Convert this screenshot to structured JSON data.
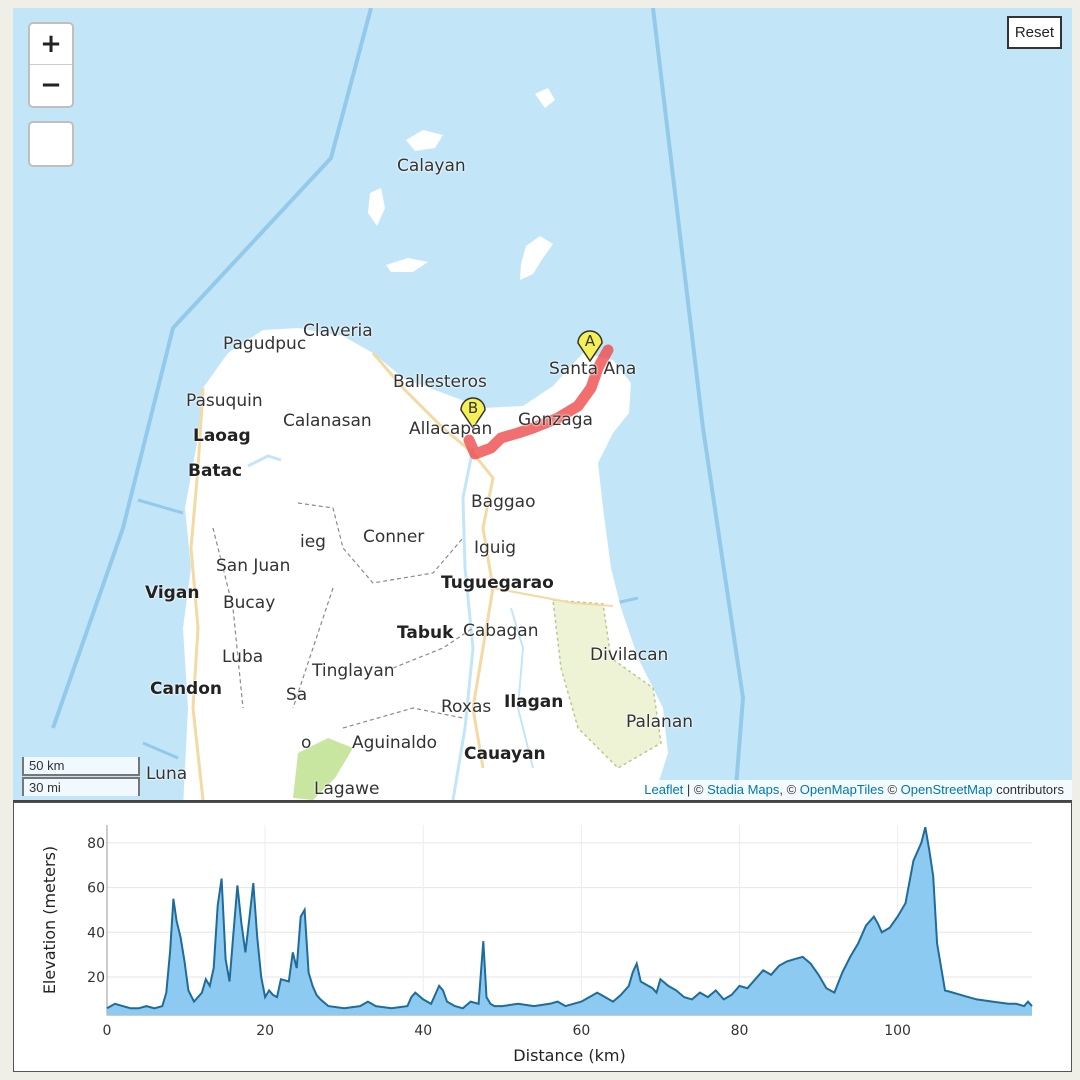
{
  "map": {
    "zoom_in_label": "+",
    "zoom_out_label": "−",
    "reset_label": "Reset",
    "scale_km": "50 km",
    "scale_mi": "30 mi",
    "attribution": {
      "leaflet": "Leaflet",
      "sep": " | © ",
      "stadia": "Stadia Maps",
      "mid": ", © ",
      "openmaptiles": "OpenMapTiles",
      "mid2": " © ",
      "osm": "OpenStreetMap",
      "tail": " contributors"
    },
    "markers": [
      {
        "label": "A"
      },
      {
        "label": "B"
      }
    ],
    "colors": {
      "water": "#c2e6f8",
      "land": "#ffffff",
      "route": "#ee4b4b",
      "marker": "#f6f057",
      "park": "#e9f3cf"
    },
    "places": [
      {
        "name": "Calayan",
        "bold": false
      },
      {
        "name": "Claveria",
        "bold": false
      },
      {
        "name": "Pagudpuc",
        "bold": false
      },
      {
        "name": "Santa Ana",
        "bold": false
      },
      {
        "name": "Ballesteros",
        "bold": false
      },
      {
        "name": "Pasuquin",
        "bold": false
      },
      {
        "name": "Calanasan",
        "bold": false
      },
      {
        "name": "Laoag",
        "bold": true
      },
      {
        "name": "Allacapan",
        "bold": false
      },
      {
        "name": "Gonzaga",
        "bold": false
      },
      {
        "name": "Batac",
        "bold": true
      },
      {
        "name": "Baggao",
        "bold": false
      },
      {
        "name": "ieg",
        "bold": false
      },
      {
        "name": "Conner",
        "bold": false
      },
      {
        "name": "Iguig",
        "bold": false
      },
      {
        "name": "San Juan",
        "bold": false
      },
      {
        "name": "Tuguegarao",
        "bold": true
      },
      {
        "name": "Vigan",
        "bold": true
      },
      {
        "name": "Bucay",
        "bold": false
      },
      {
        "name": "Tabuk",
        "bold": true
      },
      {
        "name": "Cabagan",
        "bold": false
      },
      {
        "name": "Divilacan",
        "bold": false
      },
      {
        "name": "Luba",
        "bold": false
      },
      {
        "name": "Tinglayan",
        "bold": false
      },
      {
        "name": "Candon",
        "bold": true
      },
      {
        "name": "Sa",
        "bold": false
      },
      {
        "name": "Roxas",
        "bold": false
      },
      {
        "name": "Ilagan",
        "bold": true
      },
      {
        "name": "Palanan",
        "bold": false
      },
      {
        "name": "o",
        "bold": false
      },
      {
        "name": "Aguinaldo",
        "bold": false
      },
      {
        "name": "Cauayan",
        "bold": true
      },
      {
        "name": "Luna",
        "bold": false
      },
      {
        "name": "Lagawe",
        "bold": false
      }
    ]
  },
  "chart_data": {
    "type": "area",
    "title": "",
    "xlabel": "Distance (km)",
    "ylabel": "Elevation (meters)",
    "xlim": [
      0,
      117
    ],
    "ylim": [
      3,
      88
    ],
    "xticks": [
      0,
      20,
      40,
      60,
      80,
      100
    ],
    "yticks": [
      20,
      40,
      60,
      80
    ],
    "fill_color": "#8ccaf1",
    "line_color": "#1f6b99",
    "x": [
      0,
      1,
      2,
      3,
      4,
      5,
      6,
      7,
      7.5,
      8,
      8.4,
      8.8,
      9.3,
      9.8,
      10.3,
      11,
      12,
      12.5,
      13,
      13.5,
      14,
      14.5,
      15,
      15.5,
      16,
      16.5,
      17,
      17.5,
      18,
      18.5,
      19,
      19.5,
      20,
      20.5,
      21,
      21.5,
      22,
      23,
      23.5,
      24,
      24.5,
      25,
      25.5,
      26,
      26.5,
      27,
      28,
      30,
      32,
      33,
      34,
      36,
      38,
      38.5,
      39,
      40,
      41,
      41.5,
      42,
      42.5,
      43,
      44,
      45,
      46,
      47,
      47.6,
      48,
      48.5,
      49,
      50,
      52,
      54,
      56,
      57,
      58,
      59,
      60,
      61,
      62,
      63,
      64,
      65,
      66,
      66.5,
      67,
      67.5,
      68,
      69,
      69.5,
      70,
      71,
      72,
      73,
      74,
      75,
      76,
      77,
      78,
      79,
      80,
      81,
      82,
      83,
      84,
      85,
      86,
      87,
      88,
      89,
      90,
      91,
      92,
      93,
      94,
      95,
      96,
      97,
      97.5,
      98,
      99,
      100,
      101,
      102,
      103,
      103.5,
      104,
      104.5,
      105,
      106,
      107,
      108,
      110,
      112,
      114,
      115,
      116,
      116.5,
      117
    ],
    "y": [
      6,
      8,
      7,
      6,
      6,
      7,
      6,
      7,
      13,
      32,
      55,
      45,
      38,
      27,
      14,
      9,
      13,
      19,
      16,
      24,
      52,
      64,
      28,
      18,
      40,
      61,
      44,
      31,
      46,
      62,
      38,
      20,
      11,
      14,
      12,
      11,
      19,
      18,
      31,
      24,
      47,
      50,
      22,
      16,
      12,
      10,
      7,
      6,
      7,
      9,
      7,
      6,
      7,
      11,
      13,
      10,
      8,
      12,
      16,
      14,
      9,
      7,
      6,
      9,
      8,
      36,
      11,
      8,
      7,
      7,
      8,
      7,
      8,
      9,
      7,
      8,
      9,
      11,
      13,
      11,
      9,
      12,
      16,
      22,
      26,
      18,
      17,
      15,
      13,
      19,
      16,
      14,
      11,
      10,
      13,
      11,
      14,
      10,
      12,
      16,
      15,
      19,
      23,
      21,
      25,
      27,
      28,
      29,
      26,
      21,
      15,
      13,
      22,
      29,
      35,
      43,
      47,
      44,
      40,
      42,
      47,
      53,
      72,
      80,
      87,
      77,
      65,
      35,
      14,
      13,
      12,
      10,
      9,
      8,
      8,
      7,
      9,
      7
    ]
  }
}
